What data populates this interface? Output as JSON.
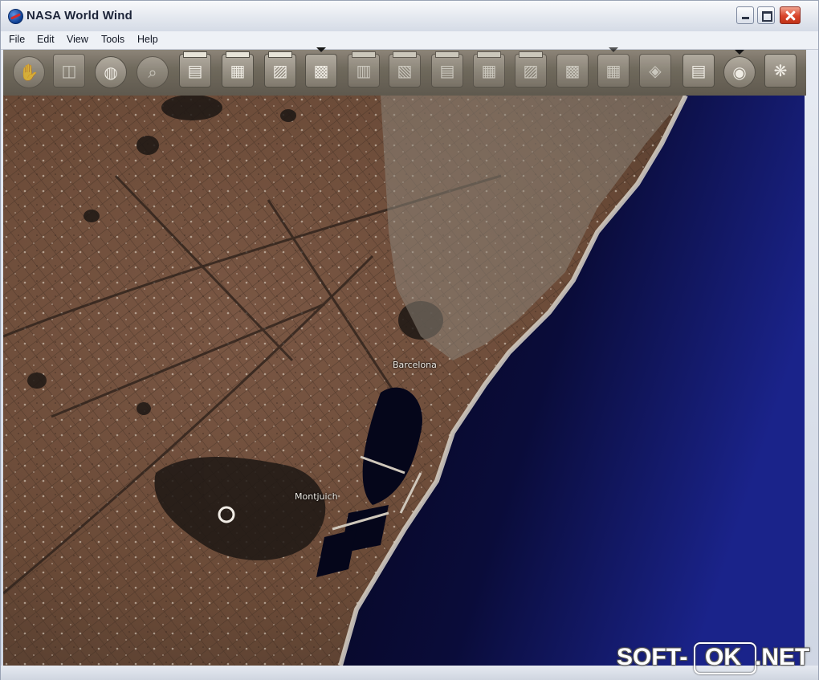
{
  "window": {
    "title": "NASA World Wind"
  },
  "menu": {
    "items": [
      "File",
      "Edit",
      "View",
      "Tools",
      "Help"
    ]
  },
  "toolbar": {
    "tools": [
      {
        "icon": "hand-pan-icon",
        "glyph": "✋"
      },
      {
        "icon": "world-map-icon",
        "glyph": "◫"
      },
      {
        "icon": "blue-globe-icon",
        "glyph": "◍"
      },
      {
        "icon": "magnifier-icon",
        "glyph": "⌕"
      },
      {
        "icon": "layer-landsat-icon",
        "glyph": "▤"
      },
      {
        "icon": "layer-terrain-icon",
        "glyph": "▦"
      },
      {
        "icon": "layer-heatmap-icon",
        "glyph": "▨"
      },
      {
        "icon": "layer-usgs-photo-icon",
        "glyph": "▩"
      },
      {
        "icon": "layer-topo-icon",
        "glyph": "▥"
      },
      {
        "icon": "layer-urban-icon",
        "glyph": "▧"
      },
      {
        "icon": "layer-street-icon",
        "glyph": "▤"
      },
      {
        "icon": "layer-satellite-icon",
        "glyph": "▦"
      },
      {
        "icon": "layer-relief-icon",
        "glyph": "▨"
      },
      {
        "icon": "layer-scan-icon",
        "glyph": "▩"
      },
      {
        "icon": "layer-grid-icon",
        "glyph": "▦"
      },
      {
        "icon": "rapid-fire-icon",
        "glyph": "◈"
      },
      {
        "icon": "placenames-icon",
        "glyph": "▤"
      },
      {
        "icon": "compass-globe-icon",
        "glyph": "◉"
      },
      {
        "icon": "world-wind-logo-icon",
        "glyph": "❋"
      }
    ]
  },
  "map": {
    "labels": {
      "barcelona": "Barcelona",
      "montjuich": "Montjuich"
    },
    "colors": {
      "land": "#6e4f3b",
      "sea": "#08091f",
      "sea_far": "#16207a",
      "coast": "#c9c4bb"
    }
  },
  "watermark": {
    "part_a": "SOFT-",
    "part_b": "OK",
    "part_c": ".NET"
  }
}
